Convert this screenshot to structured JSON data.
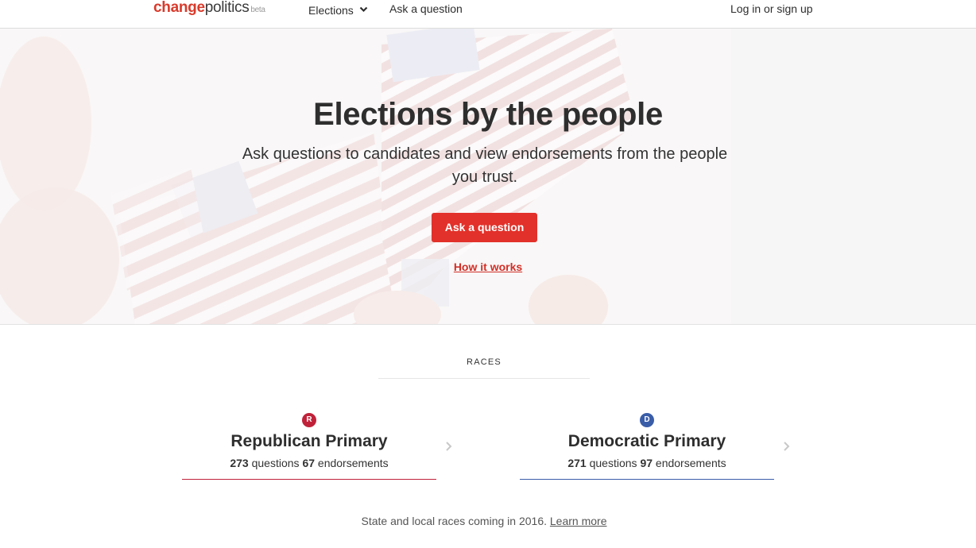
{
  "header": {
    "logo_change": "change",
    "logo_politics": "politics",
    "logo_beta": "beta",
    "nav_elections": "Elections",
    "nav_ask": "Ask a question",
    "login": "Log in or sign up"
  },
  "hero": {
    "title": "Elections by the people",
    "subtitle": "Ask questions to candidates and view endorsements from the people you trust.",
    "cta": "Ask a question",
    "how_link": "How it works"
  },
  "races": {
    "label": "RACES",
    "items": [
      {
        "badge": "R",
        "name": "Republican Primary",
        "questions": "273",
        "questions_label": "questions",
        "endorsements": "67",
        "endorsements_label": "endorsements",
        "color": "#c0223a"
      },
      {
        "badge": "D",
        "name": "Democratic Primary",
        "questions": "271",
        "questions_label": "questions",
        "endorsements": "97",
        "endorsements_label": "endorsements",
        "color": "#3a5da8"
      }
    ]
  },
  "footer": {
    "note": "State and local races coming in 2016.",
    "learn_more": "Learn more"
  },
  "colors": {
    "accent_red": "#e2312a",
    "link_red": "#d22f27",
    "republican": "#c0223a",
    "democrat": "#3a5da8"
  }
}
